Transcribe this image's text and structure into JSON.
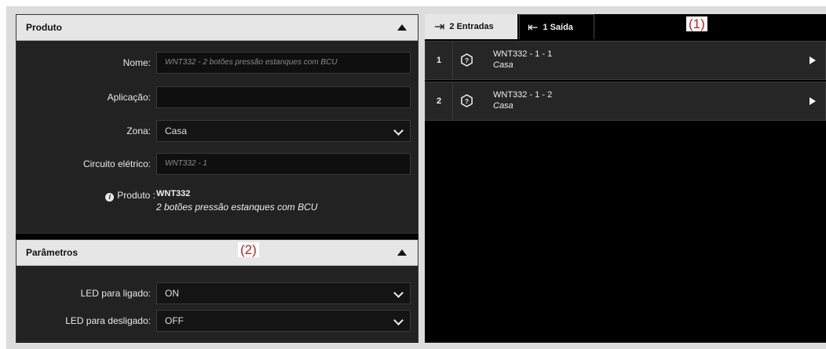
{
  "produto_panel": {
    "title": "Produto",
    "fields": {
      "nome": {
        "label": "Nome:",
        "placeholder": "WNT332 - 2 botões pressão estanques com BCU"
      },
      "aplicacao": {
        "label": "Aplicação:",
        "value": ""
      },
      "zona": {
        "label": "Zona:",
        "value": "Casa"
      },
      "circuito": {
        "label": "Circuito elétrico:",
        "placeholder": "WNT332 - 1"
      }
    },
    "product_info": {
      "label": "Produto :",
      "info_icon": "info-icon",
      "code": "WNT332",
      "description": "2 botões pressão estanques com BCU"
    }
  },
  "parametros_panel": {
    "title": "Parâmetros",
    "led_on": {
      "label": "LED para ligado:",
      "value": "ON"
    },
    "led_off": {
      "label": "LED para desligado:",
      "value": "OFF"
    }
  },
  "tabs": [
    {
      "label": "2 Entradas",
      "icon": "input-arrow-icon",
      "active": true
    },
    {
      "label": "1 Saída",
      "icon": "output-arrow-icon",
      "active": false
    }
  ],
  "entries": [
    {
      "index": "1",
      "title": "WNT332 - 1 - 1",
      "subtitle": "Casa",
      "icon": "question-shield-icon"
    },
    {
      "index": "2",
      "title": "WNT332 - 1 - 2",
      "subtitle": "Casa",
      "icon": "question-shield-icon"
    }
  ],
  "annotations": {
    "one": "(1)",
    "two": "(2)"
  },
  "colors": {
    "panel_header": "#e6e6e6",
    "panel_body": "#222222",
    "background": "#000000",
    "annotation": "#c02020"
  }
}
